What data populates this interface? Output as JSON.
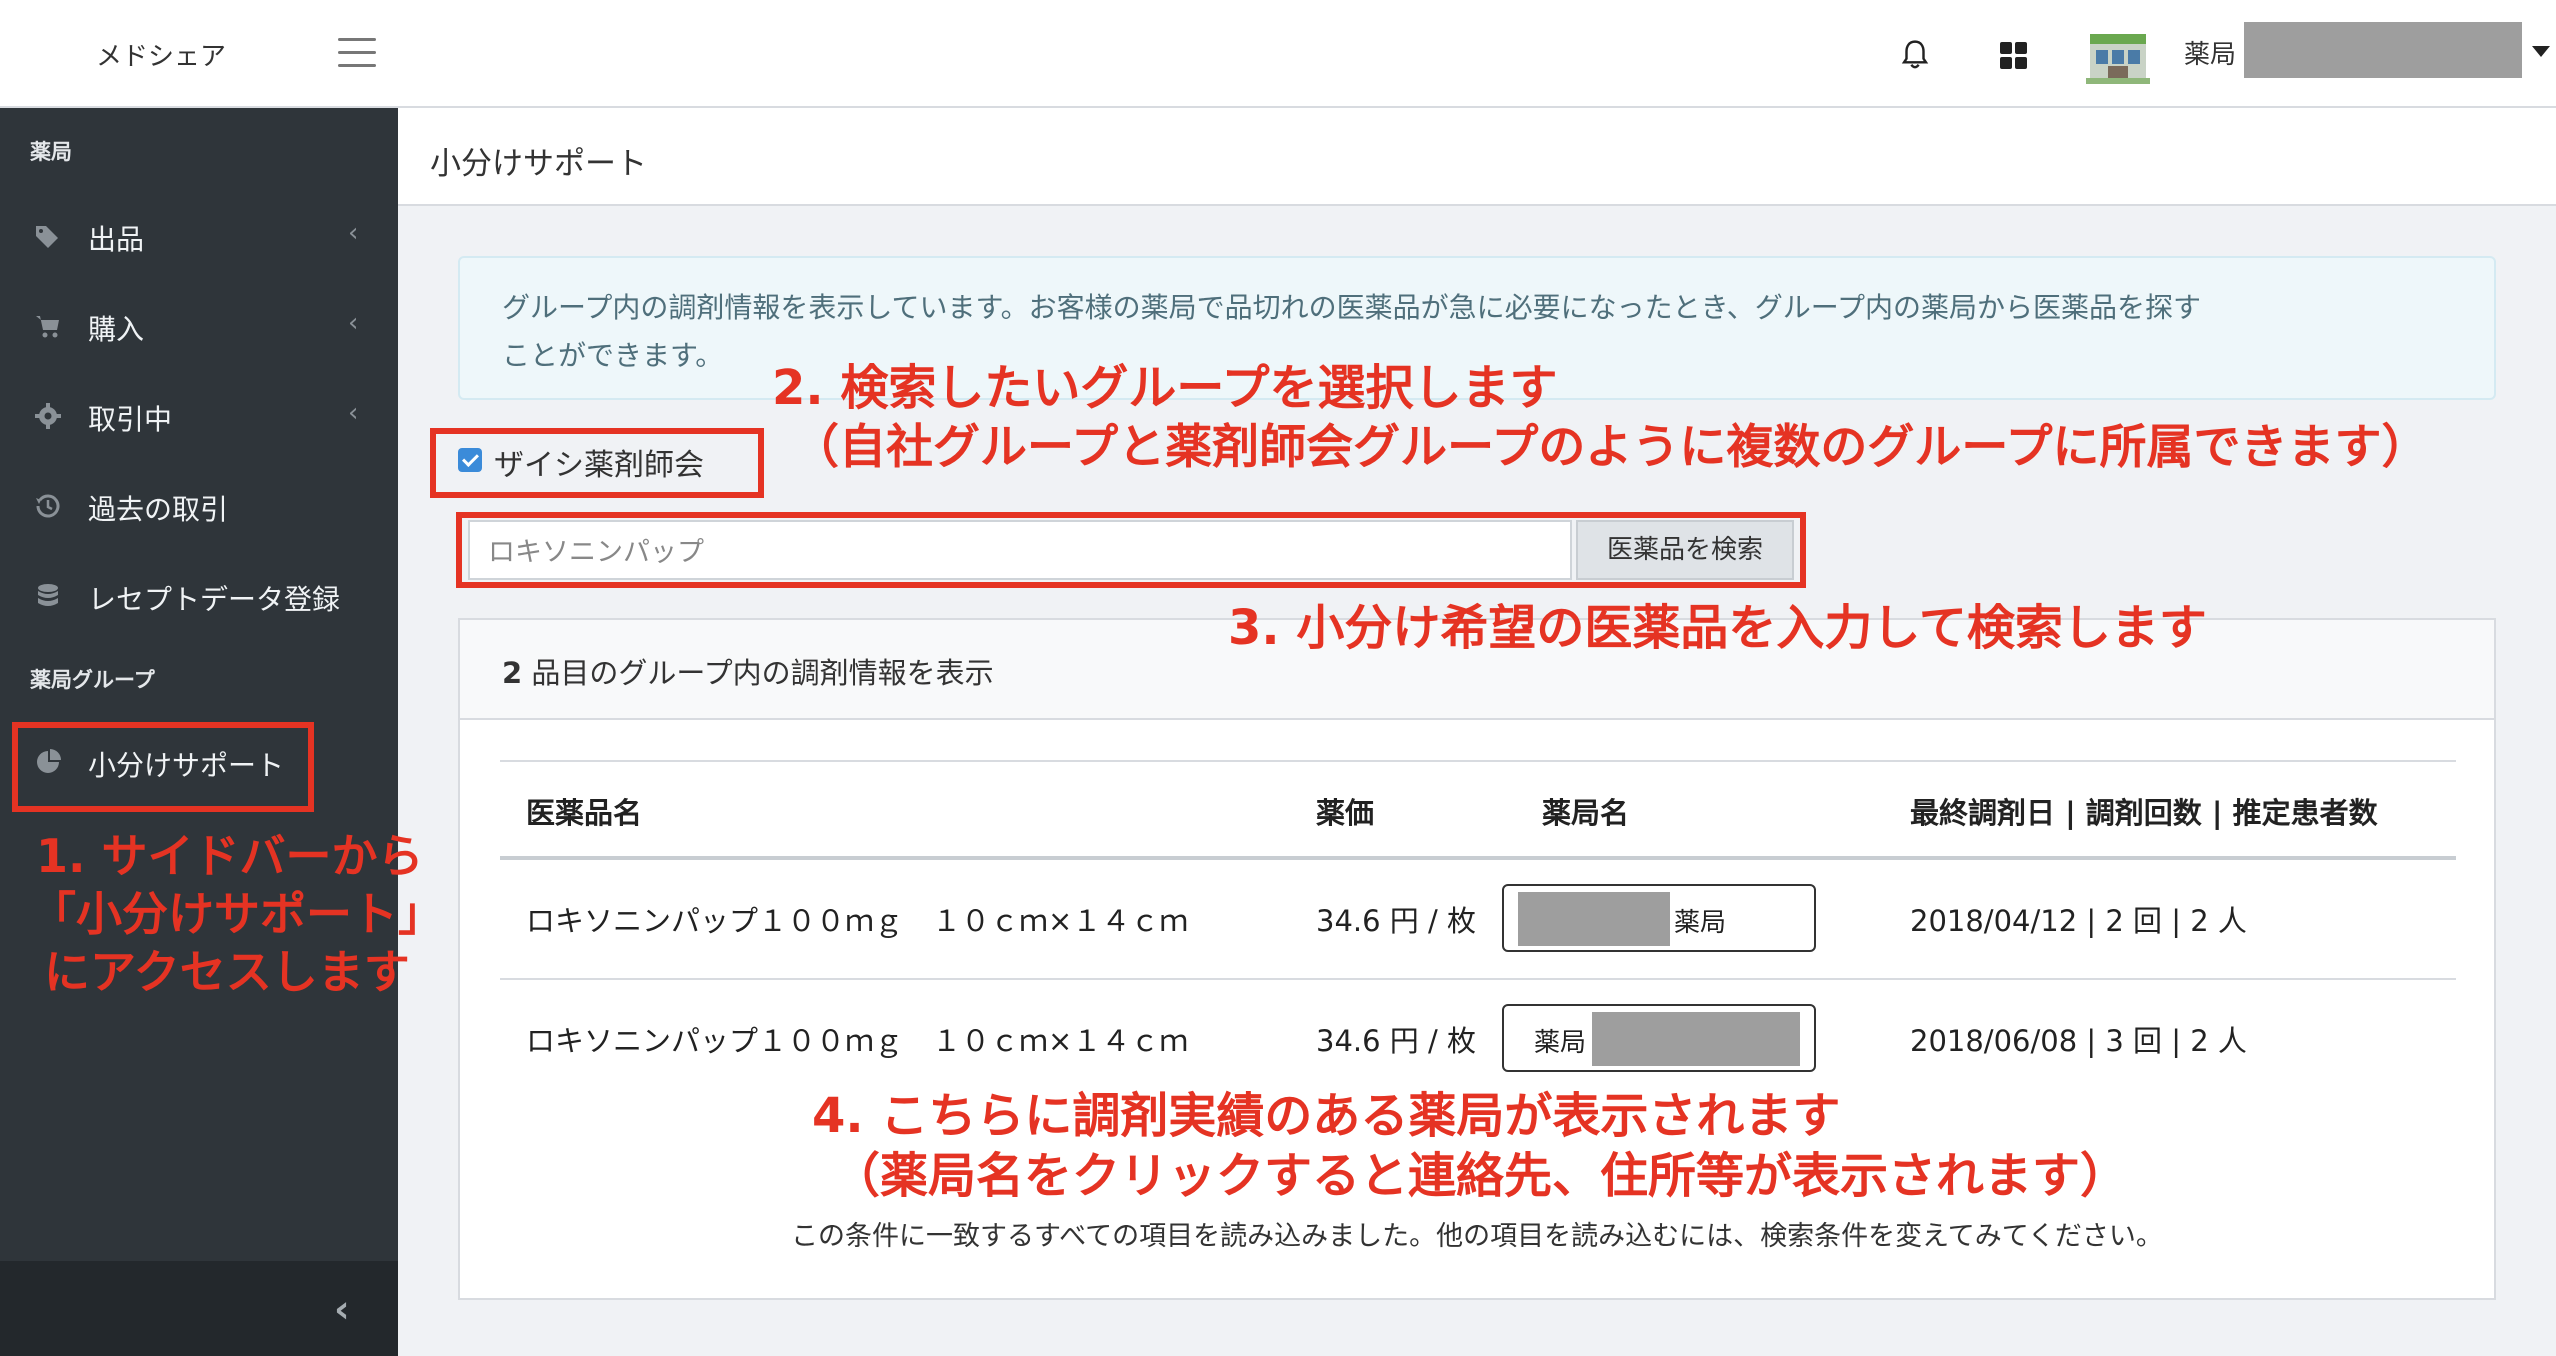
{
  "topbar": {
    "brand": "メドシェア",
    "user_name": "薬局",
    "icons": [
      "menu-icon",
      "bell-icon",
      "apps-grid-icon",
      "pharmacy-avatar",
      "caret-down-icon"
    ]
  },
  "sidebar": {
    "section1": "薬局",
    "items": [
      {
        "label": "出品",
        "icon": "tags-icon"
      },
      {
        "label": "購入",
        "icon": "cart-icon"
      },
      {
        "label": "取引中",
        "icon": "gear-icon"
      },
      {
        "label": "過去の取引",
        "icon": "history-icon"
      },
      {
        "label": "レセプトデータ登録",
        "icon": "database-icon"
      }
    ],
    "section2": "薬局グループ",
    "group_item": {
      "label": "小分けサポート",
      "icon": "pie-chart-icon"
    },
    "collapse": "‹"
  },
  "header": {
    "title": "小分けサポート"
  },
  "alert": {
    "line1": "グループ内の調剤情報を表示しています。お客様の薬局で品切れの医薬品が急に必要になったとき、グループ内の薬局から医薬品を探す",
    "line2": "ことができます。"
  },
  "group_filter": {
    "label": "ザイシ薬剤師会",
    "checked": true
  },
  "search": {
    "value": "ロキソニンパップ",
    "button": "医薬品を検索"
  },
  "card": {
    "count": "2",
    "title_suffix": "品目のグループ内の調剤情報を表示",
    "columns": [
      "医薬品名",
      "薬価",
      "薬局名",
      "最終調剤日 | 調剤回数 | 推定患者数"
    ],
    "rows": [
      {
        "drug": "ロキソニンパップ１００ｍｇ　１０ｃｍ×１４ｃｍ",
        "price": "34.6 円 / 枚",
        "pharmacy": "薬局",
        "stats": "2018/04/12 | 2 回 | 2 人"
      },
      {
        "drug": "ロキソニンパップ１００ｍｇ　１０ｃｍ×１４ｃｍ",
        "price": "34.6 円 / 枚",
        "pharmacy": "薬局",
        "stats": "2018/06/08 | 3 回 | 2 人"
      }
    ],
    "footer": "この条件に一致するすべての項目を読み込みました。他の項目を読み込むには、検索条件を変えてみてください。"
  },
  "annotations": {
    "a1_line1": "1. サイドバーから",
    "a1_line2": "「小分けサポート」",
    "a1_line3": "にアクセスします",
    "a2_line1": "2. 検索したいグループを選択します",
    "a2_line2": "（自社グループと薬剤師会グループのように複数のグループに所属できます）",
    "a3": "3. 小分け希望の医薬品を入力して検索します",
    "a4_line1": "4. こちらに調剤実績のある薬局が表示されます",
    "a4_line2": "（薬局名をクリックすると連絡先、住所等が表示されます）",
    "color": "#e53323"
  }
}
